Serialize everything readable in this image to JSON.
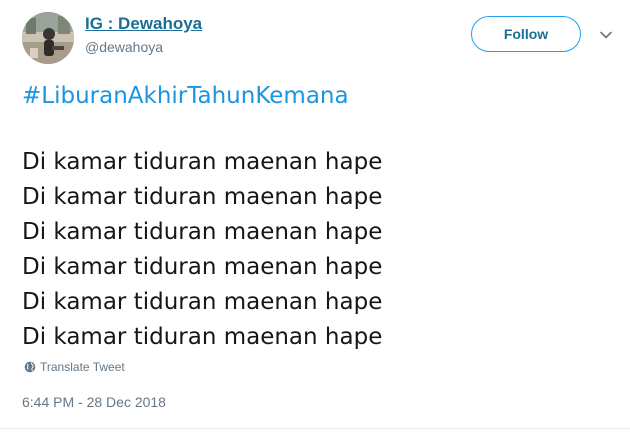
{
  "user": {
    "display_name": "IG : Dewahoya",
    "handle": "@dewahoya",
    "avatar_icon": "profile-photo"
  },
  "actions": {
    "follow_label": "Follow",
    "more_icon": "chevron-down-icon"
  },
  "tweet": {
    "hashtag": "#LiburanAkhirTahunKemana",
    "lines": [
      "Di kamar tiduran maenan hape",
      "Di kamar tiduran maenan hape",
      "Di kamar tiduran maenan hape",
      "Di kamar tiduran maenan hape",
      "Di kamar tiduran maenan hape",
      "Di kamar tiduran maenan hape"
    ],
    "translate_label": "Translate Tweet",
    "timestamp": "6:44 PM - 28 Dec 2018"
  },
  "colors": {
    "link": "#1b95e0",
    "name": "#1b6e95",
    "muted": "#657786",
    "follow_border": "#1da1f2"
  }
}
